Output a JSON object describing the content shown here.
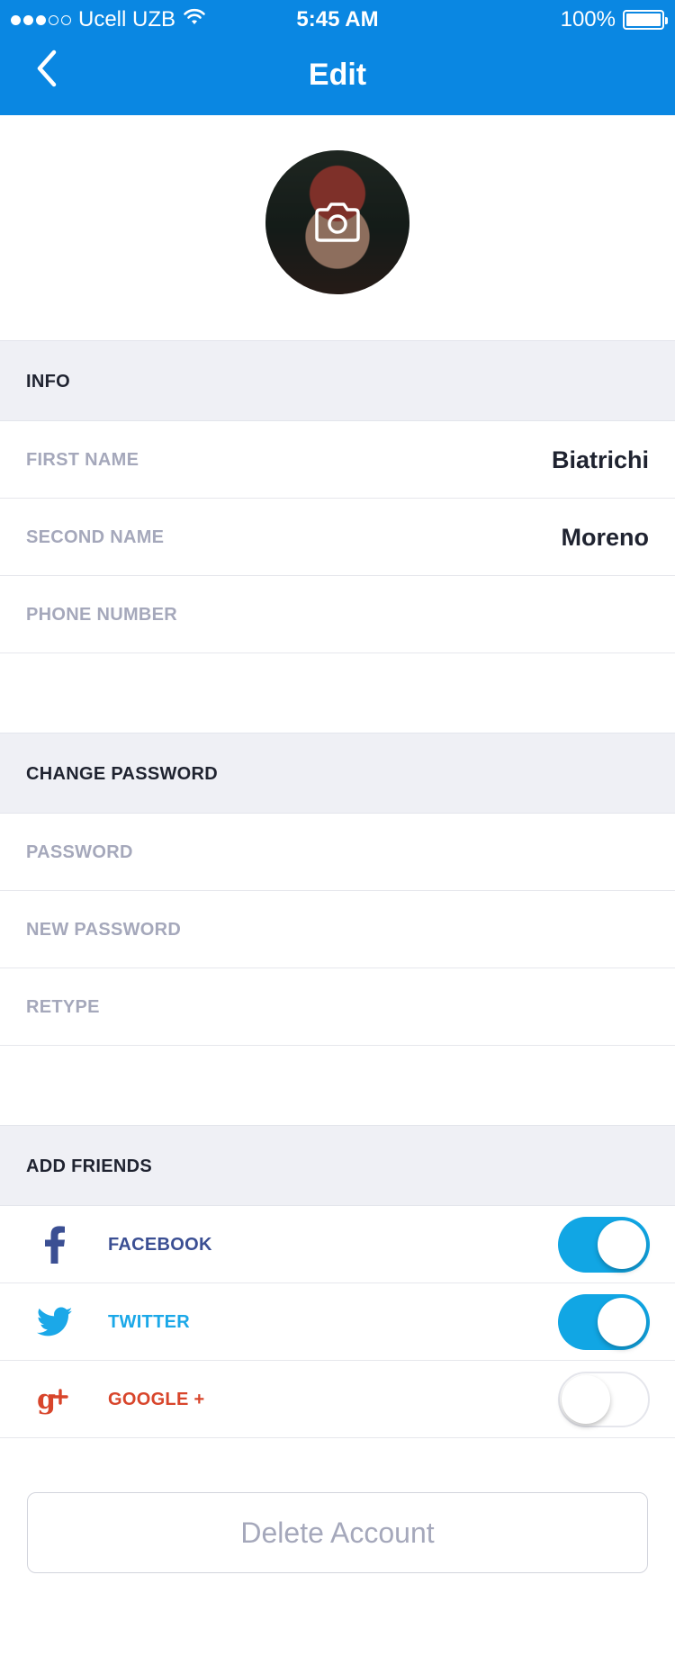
{
  "status_bar": {
    "carrier": "Ucell UZB",
    "time": "5:45 AM",
    "battery": "100%",
    "signal_dots_filled": 3,
    "signal_dots_total": 5
  },
  "nav": {
    "back_icon": "chevron-left-icon",
    "title": "Edit"
  },
  "avatar": {
    "overlay_icon": "camera-icon"
  },
  "info": {
    "title": "INFO",
    "first_name_label": "FIRST NAME",
    "first_name_value": "Biatrichi",
    "second_name_label": "SECOND NAME",
    "second_name_value": "Moreno",
    "phone_label": "PHONE NUMBER",
    "phone_value": ""
  },
  "password": {
    "title": "CHANGE PASSWORD",
    "password_label": "PASSWORD",
    "new_password_label": "NEW PASSWORD",
    "retype_label": "RETYPE"
  },
  "friends": {
    "title": "ADD FRIENDS",
    "items": [
      {
        "label": "FACEBOOK",
        "icon": "facebook-icon",
        "color": "#3b4f93",
        "enabled": true
      },
      {
        "label": "TWITTER",
        "icon": "twitter-icon",
        "color": "#1ba8e8",
        "enabled": true
      },
      {
        "label": "GOOGLE +",
        "icon": "google-plus-icon",
        "color": "#d8452b",
        "enabled": false
      }
    ]
  },
  "delete_label": "Delete Account",
  "colors": {
    "header": "#0a87e2",
    "toggle_on": "#11a6e4",
    "section_bg": "#eff0f5",
    "muted_text": "#a5a8bb"
  }
}
